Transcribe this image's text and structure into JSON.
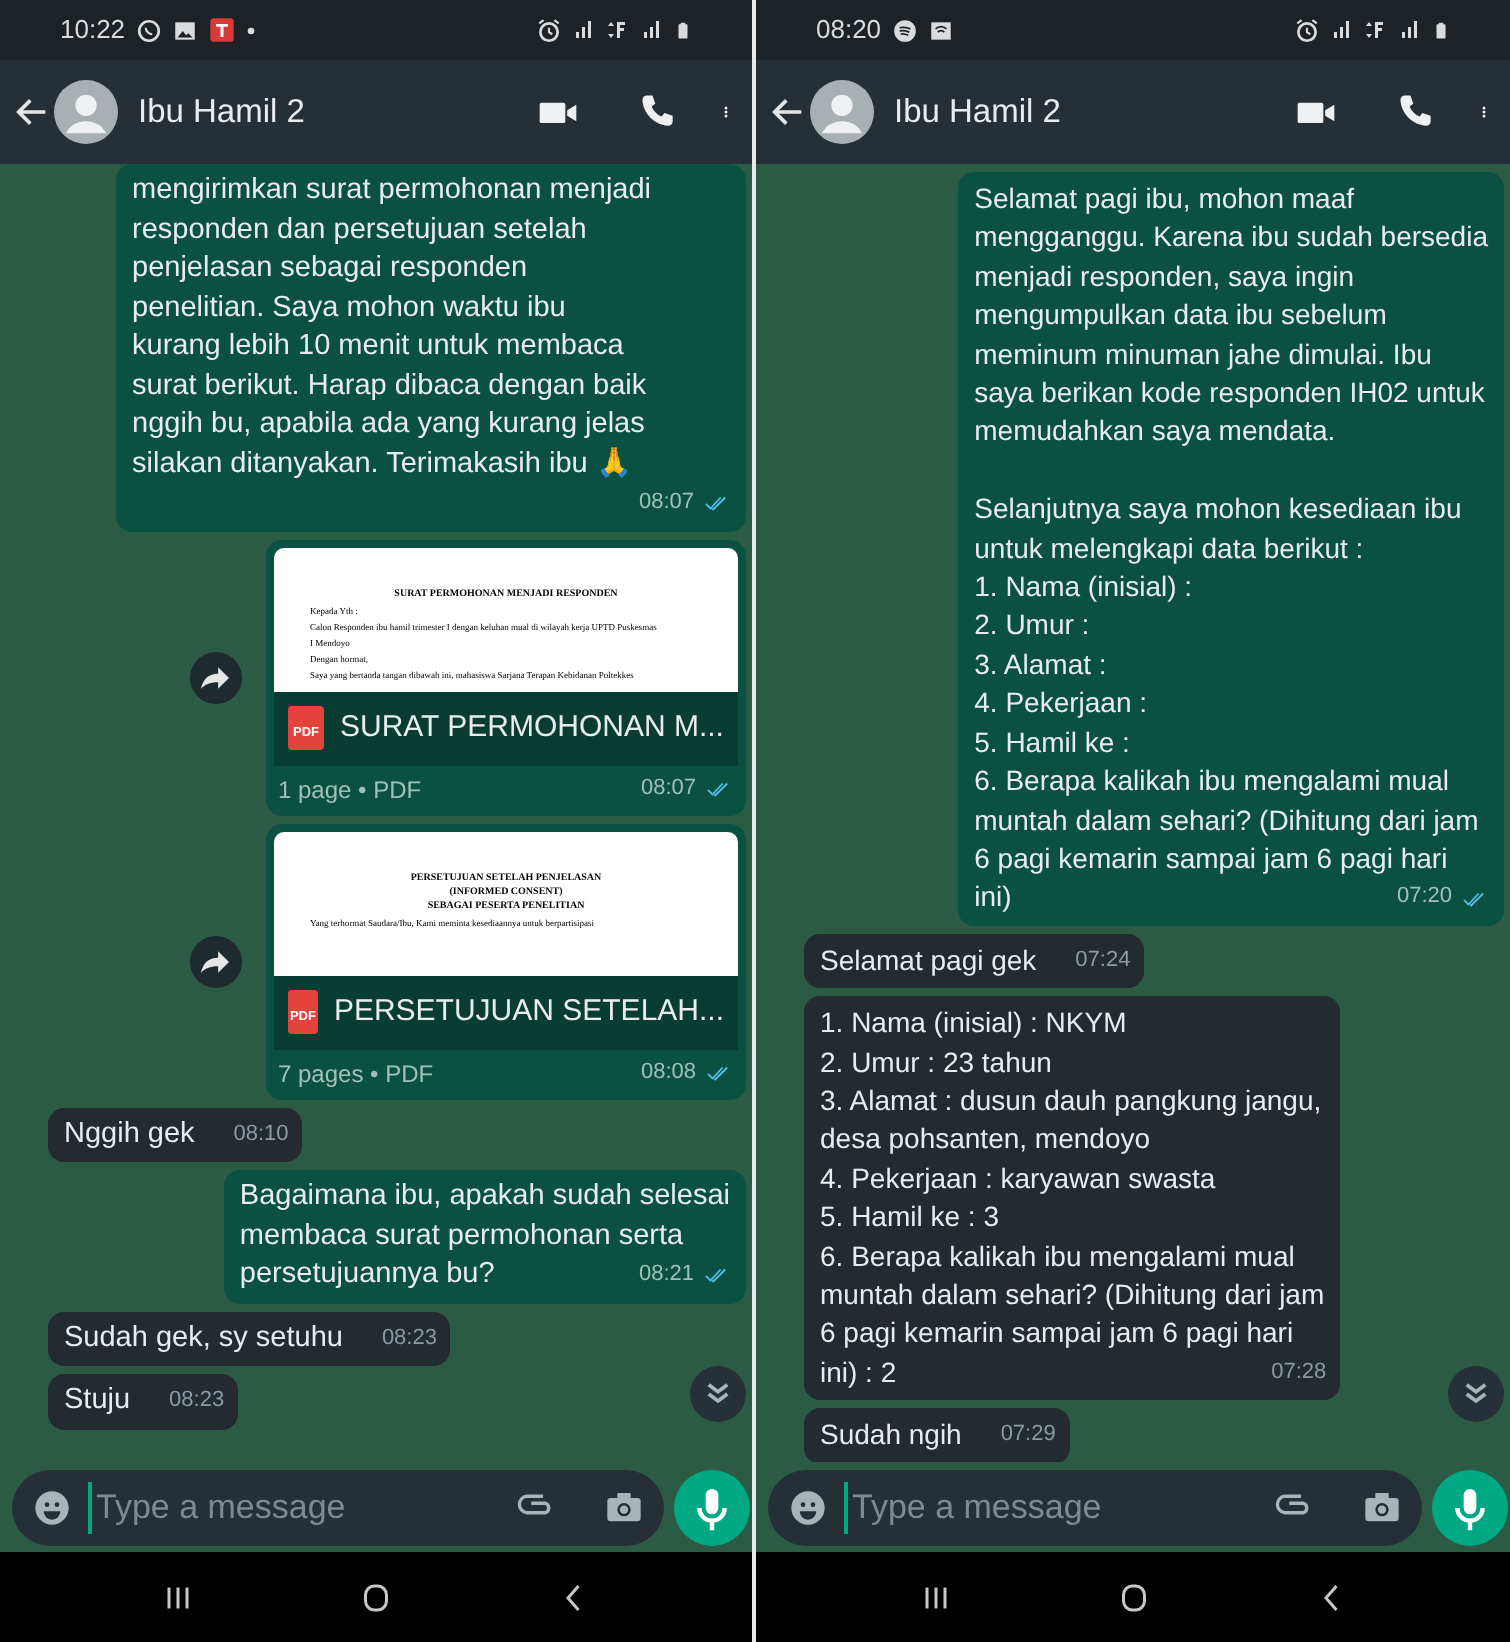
{
  "panels": [
    {
      "status_bar": {
        "time": "10:22"
      },
      "header": {
        "contact_name": "Ibu Hamil 2"
      },
      "messages": [
        {
          "kind": "text",
          "outgoing": true,
          "text": "mengirimkan surat permohonan menjadi\nresponden dan persetujuan setelah\npenjelasan sebagai responden\npenelitian. Saya mohon waktu ibu\nkurang lebih 10 menit untuk membaca\nsurat berikut. Harap dibaca dengan baik\nnggih bu, apabila ada yang kurang jelas\nsilakan ditanyakan. Terimakasih ibu 🙏",
          "time": "08:07",
          "read": true
        },
        {
          "kind": "document",
          "outgoing": true,
          "preview": {
            "heading_lines": [
              "SURAT PERMOHONAN MENJADI RESPONDEN"
            ],
            "body_lines": [
              "Kepada Yth :",
              "Calon Responden ibu hamil trimester I dengan keluhan mual di wilayah kerja UPTD Puskesmas",
              "I Mendoyo",
              "Dengan hormat,",
              "Saya yang bertanda tangan dibawah ini, mahasiswa Sarjana Terapan Kebidanan Poltekkes"
            ]
          },
          "icon_label": "PDF",
          "file_name": "SURAT PERMOHONAN M...",
          "details": "1 page • PDF",
          "time": "08:07",
          "read": true
        },
        {
          "kind": "document",
          "outgoing": true,
          "preview": {
            "heading_lines": [
              "PERSETUJUAN SETELAH PENJELASAN",
              "(INFORMED CONSENT)",
              "SEBAGAI PESERTA PENELITIAN"
            ],
            "body_lines": [
              "Yang terhormat Saudara/Ibu, Kami meminta kesediaannya untuk berpartisipasi"
            ]
          },
          "icon_label": "PDF",
          "file_name": "PERSETUJUAN SETELAH...",
          "details": "7 pages • PDF",
          "time": "08:08",
          "read": true
        },
        {
          "kind": "text",
          "outgoing": false,
          "text": "Nggih gek",
          "time": "08:10"
        },
        {
          "kind": "text",
          "outgoing": true,
          "text": "Bagaimana ibu, apakah sudah selesai\nmembaca surat permohonan serta\npersetujuannya bu?",
          "time": "08:21",
          "read": true
        },
        {
          "kind": "text",
          "outgoing": false,
          "text": "Sudah gek, sy setuhu",
          "time": "08:23"
        },
        {
          "kind": "text",
          "outgoing": false,
          "text": "Stuju",
          "time": "08:23"
        }
      ],
      "composer": {
        "placeholder": "Type a message"
      }
    },
    {
      "status_bar": {
        "time": "08:20"
      },
      "header": {
        "contact_name": "Ibu Hamil 2"
      },
      "messages": [
        {
          "kind": "text",
          "outgoing": true,
          "text": "Selamat pagi ibu, mohon maaf\nmengganggu. Karena ibu sudah bersedia\nmenjadi responden, saya ingin\nmengumpulkan data ibu sebelum\nmeminum minuman jahe dimulai. Ibu\nsaya berikan kode responden IH02 untuk\nmemudahkan saya mendata.\n\nSelanjutnya saya mohon kesediaan ibu\nuntuk melengkapi data berikut :\n1. Nama (inisial) :\n2. Umur :\n3. Alamat :\n4. Pekerjaan :\n5. Hamil ke :\n6. Berapa kalikah ibu mengalami mual\nmuntah dalam sehari? (Dihitung dari jam\n6 pagi kemarin sampai jam 6 pagi hari\nini)",
          "time": "07:20",
          "read": true
        },
        {
          "kind": "text",
          "outgoing": false,
          "text": "Selamat pagi gek",
          "time": "07:24"
        },
        {
          "kind": "text",
          "outgoing": false,
          "text": "1. Nama (inisial) : NKYM\n2. Umur : 23 tahun\n3. Alamat : dusun dauh pangkung jangu,\ndesa pohsanten, mendoyo\n4. Pekerjaan : karyawan swasta\n5. Hamil ke : 3\n6. Berapa kalikah ibu mengalami mual\nmuntah dalam sehari? (Dihitung dari jam\n6 pagi kemarin sampai jam 6 pagi hari\nini) : 2",
          "time": "07:28"
        },
        {
          "kind": "text",
          "outgoing": false,
          "text": "Sudah ngih",
          "time": "07:29"
        }
      ],
      "composer": {
        "placeholder": "Type a message"
      }
    }
  ]
}
